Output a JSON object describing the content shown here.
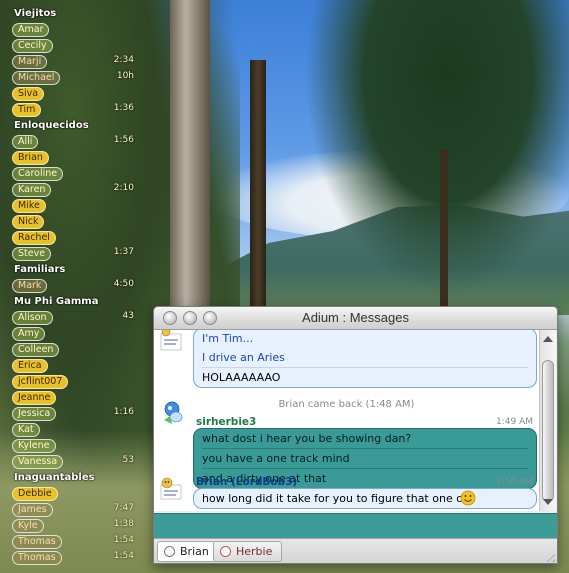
{
  "contact_list": {
    "groups": [
      {
        "name": "Viejitos",
        "contacts": [
          {
            "name": "Amar",
            "status": "available",
            "idle": ""
          },
          {
            "name": "Cecily",
            "status": "available",
            "idle": ""
          },
          {
            "name": "Marji",
            "status": "idle",
            "idle": "2:34"
          },
          {
            "name": "Michael",
            "status": "idle",
            "idle": "10h"
          },
          {
            "name": "Siva",
            "status": "active",
            "idle": ""
          },
          {
            "name": "Tim",
            "status": "active",
            "idle": "1:36"
          }
        ]
      },
      {
        "name": "Enloquecidos",
        "contacts": [
          {
            "name": "Alli",
            "status": "available",
            "idle": "1:56"
          },
          {
            "name": "Brian",
            "status": "active",
            "idle": ""
          },
          {
            "name": "Caroline",
            "status": "available",
            "idle": ""
          },
          {
            "name": "Karen",
            "status": "available",
            "idle": "2:10"
          },
          {
            "name": "Mike",
            "status": "active",
            "idle": ""
          },
          {
            "name": "Nick",
            "status": "active",
            "idle": ""
          },
          {
            "name": "Rachel",
            "status": "active",
            "idle": ""
          },
          {
            "name": "Steve",
            "status": "available",
            "idle": "1:37"
          }
        ]
      },
      {
        "name": "Familiars",
        "contacts": [
          {
            "name": "Mark",
            "status": "idle",
            "idle": "4:50"
          }
        ]
      },
      {
        "name": "Mu Phi Gamma",
        "contacts": [
          {
            "name": "Alison",
            "status": "available",
            "idle": "43"
          },
          {
            "name": "Amy",
            "status": "available",
            "idle": ""
          },
          {
            "name": "Colleen",
            "status": "available",
            "idle": ""
          },
          {
            "name": "Erica",
            "status": "active",
            "idle": ""
          },
          {
            "name": "jcflint007",
            "status": "active",
            "idle": ""
          },
          {
            "name": "Jeanne",
            "status": "active",
            "idle": ""
          },
          {
            "name": "Jessica",
            "status": "available",
            "idle": "1:16"
          },
          {
            "name": "Kat",
            "status": "available",
            "idle": ""
          },
          {
            "name": "Kylene",
            "status": "available",
            "idle": ""
          },
          {
            "name": "Vanessa",
            "status": "available",
            "idle": "53"
          }
        ]
      },
      {
        "name": "Inaguantables",
        "contacts": [
          {
            "name": "Debbie",
            "status": "active",
            "idle": ""
          },
          {
            "name": "James",
            "status": "idle",
            "idle": "7:47"
          },
          {
            "name": "Kyle",
            "status": "idle",
            "idle": "1:38"
          },
          {
            "name": "Thomas",
            "status": "idle",
            "idle": "1:54"
          },
          {
            "name": "Thomas",
            "status": "idle",
            "idle": "1:54"
          }
        ]
      }
    ]
  },
  "status_colors": {
    "available": "#96af50",
    "idle": "#968750",
    "active": "#e8c12a"
  },
  "window": {
    "title": "Adium : Messages",
    "transcript": {
      "tim_lines": [
        "I'm Tim...",
        "I drive an Aries",
        "HOLAAAAAAO"
      ],
      "status_message": "Brian came back (1:48 AM)",
      "sirherbie": {
        "sender": "sirherbie3",
        "time": "1:49 AM",
        "lines": [
          "what dost i hear you be showing dan?",
          "you have a one track mind",
          "and a dirty one at that"
        ]
      },
      "brian": {
        "sender": "Brian (LordBob3)",
        "time": "1:50 AM",
        "line": "how long did it take for you to figure that one out",
        "emoticon": "smiley-emoticon"
      }
    },
    "tabs": [
      {
        "label": "Brian",
        "selected": true
      },
      {
        "label": "Herbie",
        "selected": false
      }
    ],
    "accent_colors": {
      "teal": "#3a9a97",
      "blue_bubble": "#e8f2ff",
      "name_green": "#1f7a49",
      "name_blue": "#0d3c8c"
    }
  }
}
